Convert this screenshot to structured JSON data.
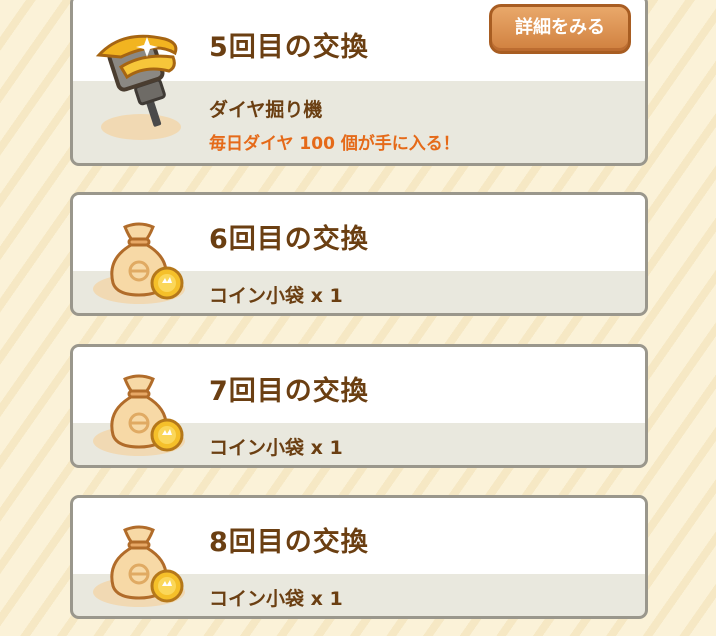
{
  "exchanges": [
    {
      "title": "5回目の交換",
      "item_name": "ダイヤ掘り機",
      "description": "毎日ダイヤ 100 個が手に入る！",
      "detail_button_label": "詳細をみる",
      "icon": "diamond-drill-icon"
    },
    {
      "title": "6回目の交換",
      "item_name": "コイン小袋 x 1",
      "icon": "coin-bag-icon"
    },
    {
      "title": "7回目の交換",
      "item_name": "コイン小袋 x 1",
      "icon": "coin-bag-icon"
    },
    {
      "title": "8回目の交換",
      "item_name": "コイン小袋 x 1",
      "icon": "coin-bag-icon"
    }
  ],
  "colors": {
    "title_text": "#6b3f12",
    "accent_orange": "#e56a19",
    "button_fill": "#d88b48",
    "card_border": "#9a978c",
    "background": "#fbf2d8"
  }
}
